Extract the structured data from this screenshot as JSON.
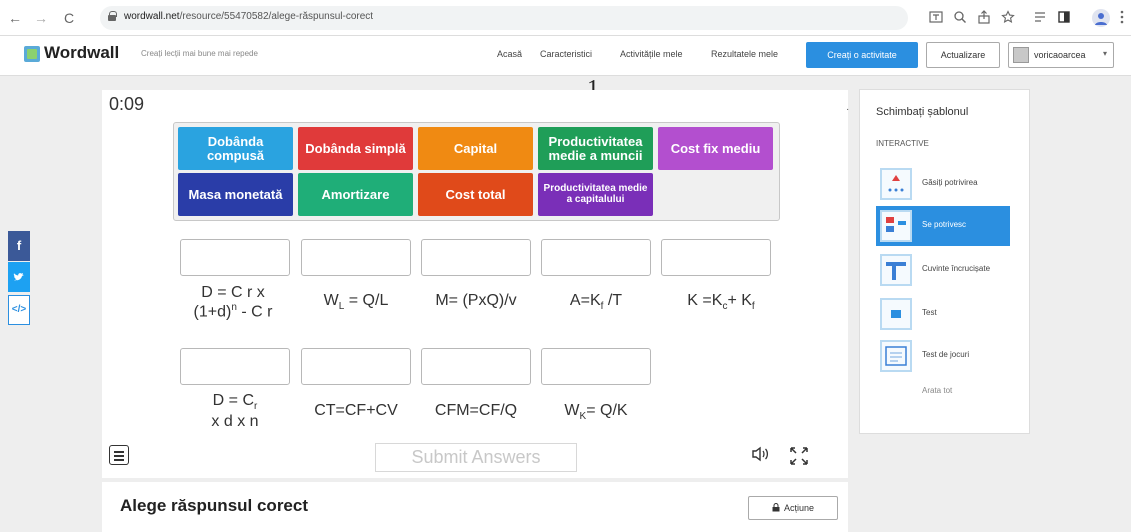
{
  "browser": {
    "url_domain": "wordwall.net",
    "url_path": "/resource/55470582/alege-răspunsul-corect",
    "back": "←",
    "forward": "→",
    "reload": "C"
  },
  "header": {
    "logo": "Wordwall",
    "tagline": "Creați lecții mai bune mai repede",
    "nav": [
      "Acasă",
      "Caracteristici",
      "Activitățile mele",
      "Rezultatele mele"
    ],
    "create": "Creați o activitate",
    "update": "Actualizare",
    "user": "voricaoarcea"
  },
  "page_number": "1",
  "game": {
    "timer": "0:09",
    "tiles": [
      {
        "label": "Dobânda compusă",
        "color": "#2aa3e0"
      },
      {
        "label": "Dobânda simplă",
        "color": "#e03a3a"
      },
      {
        "label": "Capital",
        "color": "#f08a12"
      },
      {
        "label": "Productivitatea medie a muncii",
        "color": "#1f9e58"
      },
      {
        "label": "Cost fix mediu",
        "color": "#b34fcf"
      },
      {
        "label": "Masa monetată",
        "color": "#2a3da8"
      },
      {
        "label": "Amortizare",
        "color": "#1fae78"
      },
      {
        "label": "Cost total",
        "color": "#e04a1a"
      },
      {
        "label": "Productivitatea medie a capitalului",
        "color": "#7a2fb8"
      }
    ],
    "formulas": [
      {
        "main": "D = C r x",
        "line2": "(1+d)",
        "sup": "n",
        "tail": " - C r"
      },
      {
        "pre": "W",
        "sub": "L",
        "post": " = Q/L"
      },
      {
        "text": "M= (PxQ)/v"
      },
      {
        "pre": "A=K",
        "sub": "f",
        "post": " /T"
      },
      {
        "pre": "K =K",
        "sub": "c",
        "mid": "+ K",
        "sub2": "f"
      },
      {
        "pre": "D = C",
        "sub": "r",
        "line2": "x d x n"
      },
      {
        "text": "CT=CF+CV"
      },
      {
        "text": "CFM=CF/Q"
      },
      {
        "pre": "W",
        "sub": "K",
        "post": "= Q/K"
      }
    ],
    "submit": "Submit Answers"
  },
  "side": {
    "title": "Schimbați șablonul",
    "section": "INTERACTIVE",
    "items": [
      "Găsiți potrivirea",
      "Se potrivesc",
      "Cuvinte încrucișate",
      "Test",
      "Test de jocuri"
    ],
    "more": "Arata tot"
  },
  "below": {
    "title": "Alege răspunsul corect",
    "action": "Acțiune"
  },
  "colors": {
    "facebook": "#3b5998",
    "twitter": "#1da1f2",
    "embed": "#2b8fe0",
    "accent": "#2b8fe0"
  }
}
